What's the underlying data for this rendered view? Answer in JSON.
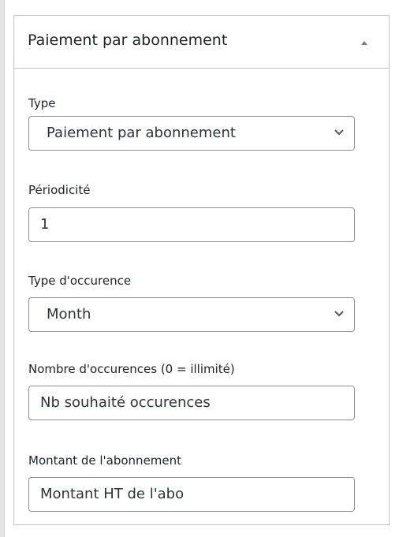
{
  "panel": {
    "title": "Paiement par abonnement",
    "toggle_icon": "arrow-up-icon"
  },
  "fields": {
    "type": {
      "label": "Type",
      "value": "Paiement par abonnement"
    },
    "periodicite": {
      "label": "Périodicité",
      "value": "1"
    },
    "type_occurence": {
      "label": "Type d'occurence",
      "value": "Month"
    },
    "nombre_occurences": {
      "label": "Nombre d'occurences (0 = illimité)",
      "value": "Nb souhaité occurences"
    },
    "montant": {
      "label": "Montant de l'abonnement",
      "value": "Montant HT de l'abo"
    }
  },
  "colors": {
    "border": "#c3c4c7",
    "field_border": "#8c8f94",
    "text": "#1d2327"
  }
}
